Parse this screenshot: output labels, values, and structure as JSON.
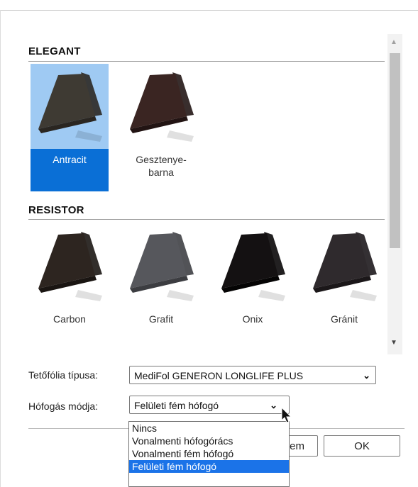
{
  "sections": [
    {
      "title": "ELEGANT",
      "items": [
        {
          "label": "Antracit",
          "selected": true,
          "color": "#3e3a33"
        },
        {
          "label": "Gesztenye-\nbarna",
          "selected": false,
          "color": "#3a2522"
        }
      ]
    },
    {
      "title": "RESISTOR",
      "items": [
        {
          "label": "Carbon",
          "selected": false,
          "color": "#2d2520"
        },
        {
          "label": "Grafit",
          "selected": false,
          "color": "#56575c"
        },
        {
          "label": "Onix",
          "selected": false,
          "color": "#141112"
        },
        {
          "label": "Gránit",
          "selected": false,
          "color": "#2f2a2d"
        }
      ]
    }
  ],
  "form": {
    "foil_label": "Tetőfólia típusa:",
    "foil_value": "MediFol GENERON LONGLIFE PLUS",
    "snow_label": "Hófogás módja:",
    "snow_value": "Felületi fém hófogó"
  },
  "dropdown": {
    "options": [
      "Nincs",
      "Vonalmenti hófogórács",
      "Vonalmenti fém hófogó",
      "Felületi fém hófogó"
    ],
    "selected_index": 3
  },
  "buttons": {
    "ok_label": "OK",
    "partial_label": "em"
  },
  "colors": {
    "selection": "#0a6fd6",
    "selection_light": "#9fcaf3",
    "dropdown_highlight": "#1b73e8"
  }
}
